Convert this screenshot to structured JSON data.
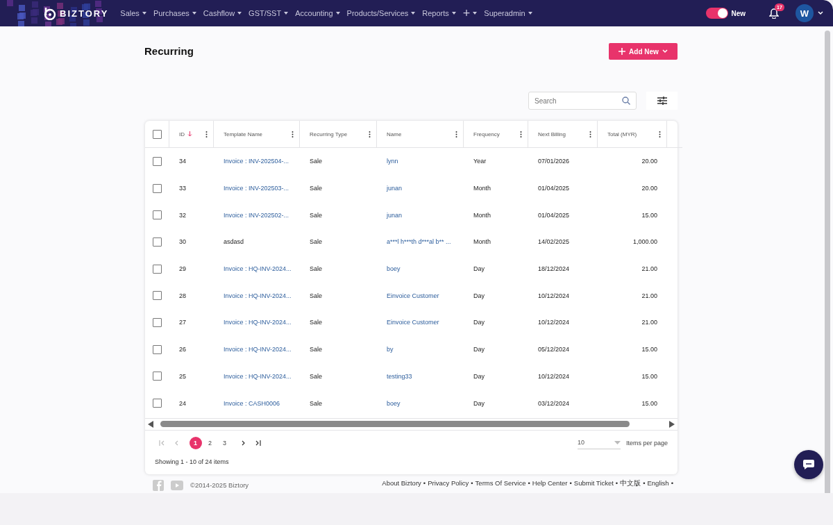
{
  "nav": {
    "brand": "BIZTORY",
    "menus": [
      {
        "label": "Sales"
      },
      {
        "label": "Purchases"
      },
      {
        "label": "Cashflow"
      },
      {
        "label": "GST/SST"
      },
      {
        "label": "Accounting"
      },
      {
        "label": "Products/Services"
      },
      {
        "label": "Reports"
      },
      {
        "label": "+"
      },
      {
        "label": "Superadmin"
      }
    ],
    "toggle": {
      "label": "New",
      "on": true
    },
    "notifications": {
      "count": "17"
    },
    "avatar": {
      "initial": "W"
    }
  },
  "page": {
    "title": "Recurring",
    "add_button": "Add New",
    "search": {
      "placeholder": "Search"
    }
  },
  "table": {
    "select_all_checked": false,
    "columns": [
      {
        "label": "ID",
        "sorted": true
      },
      {
        "label": "Template Name",
        "sorted": false
      },
      {
        "label": "Recurring Type",
        "sorted": false
      },
      {
        "label": "Name",
        "sorted": false
      },
      {
        "label": "Frequency",
        "sorted": false
      },
      {
        "label": "Next Billing",
        "sorted": false
      },
      {
        "label": "Total (MYR)",
        "sorted": false
      }
    ],
    "rows": [
      {
        "checked": false,
        "id": "34",
        "template": "Invoice : INV-202504-...",
        "template_link": true,
        "type": "Sale",
        "name": "lynn",
        "frequency": "Year",
        "next_billing": "07/01/2026",
        "total": "20.00"
      },
      {
        "checked": false,
        "id": "33",
        "template": "Invoice : INV-202503-...",
        "template_link": true,
        "type": "Sale",
        "name": "junan",
        "frequency": "Month",
        "next_billing": "01/04/2025",
        "total": "20.00"
      },
      {
        "checked": false,
        "id": "32",
        "template": "Invoice : INV-202502-...",
        "template_link": true,
        "type": "Sale",
        "name": "junan",
        "frequency": "Month",
        "next_billing": "01/04/2025",
        "total": "15.00"
      },
      {
        "checked": false,
        "id": "30",
        "template": "asdasd",
        "template_link": false,
        "type": "Sale",
        "name": "a***l h***th d***al b** ...",
        "frequency": "Month",
        "next_billing": "14/02/2025",
        "total": "1,000.00"
      },
      {
        "checked": false,
        "id": "29",
        "template": "Invoice : HQ-INV-2024...",
        "template_link": true,
        "type": "Sale",
        "name": "boey",
        "frequency": "Day",
        "next_billing": "18/12/2024",
        "total": "21.00"
      },
      {
        "checked": false,
        "id": "28",
        "template": "Invoice : HQ-INV-2024...",
        "template_link": true,
        "type": "Sale",
        "name": "Einvoice Customer",
        "frequency": "Day",
        "next_billing": "10/12/2024",
        "total": "21.00"
      },
      {
        "checked": false,
        "id": "27",
        "template": "Invoice : HQ-INV-2024...",
        "template_link": true,
        "type": "Sale",
        "name": "Einvoice Customer",
        "frequency": "Day",
        "next_billing": "10/12/2024",
        "total": "21.00"
      },
      {
        "checked": false,
        "id": "26",
        "template": "Invoice : HQ-INV-2024...",
        "template_link": true,
        "type": "Sale",
        "name": "by",
        "frequency": "Day",
        "next_billing": "05/12/2024",
        "total": "15.00"
      },
      {
        "checked": false,
        "id": "25",
        "template": "Invoice : HQ-INV-2024...",
        "template_link": true,
        "type": "Sale",
        "name": "testing33",
        "frequency": "Day",
        "next_billing": "10/12/2024",
        "total": "15.00"
      },
      {
        "checked": false,
        "id": "24",
        "template": "Invoice : CASH0006",
        "template_link": true,
        "type": "Sale",
        "name": "boey",
        "frequency": "Day",
        "next_billing": "03/12/2024",
        "total": "15.00"
      }
    ],
    "pager": {
      "pages": [
        {
          "label": "1",
          "selected": true
        },
        {
          "label": "2",
          "selected": false
        },
        {
          "label": "3",
          "selected": false
        }
      ],
      "page_size": "10",
      "page_size_label": "Items per page",
      "summary": "Showing 1 - 10 of 24 items"
    }
  },
  "footer": {
    "copyright": "©2014-2025 Biztory",
    "separator": "•",
    "links": [
      "About Biztory",
      "Privacy Policy",
      "Terms Of Service",
      "Help Center",
      "Submit Ticket",
      "中文版",
      "English"
    ]
  }
}
